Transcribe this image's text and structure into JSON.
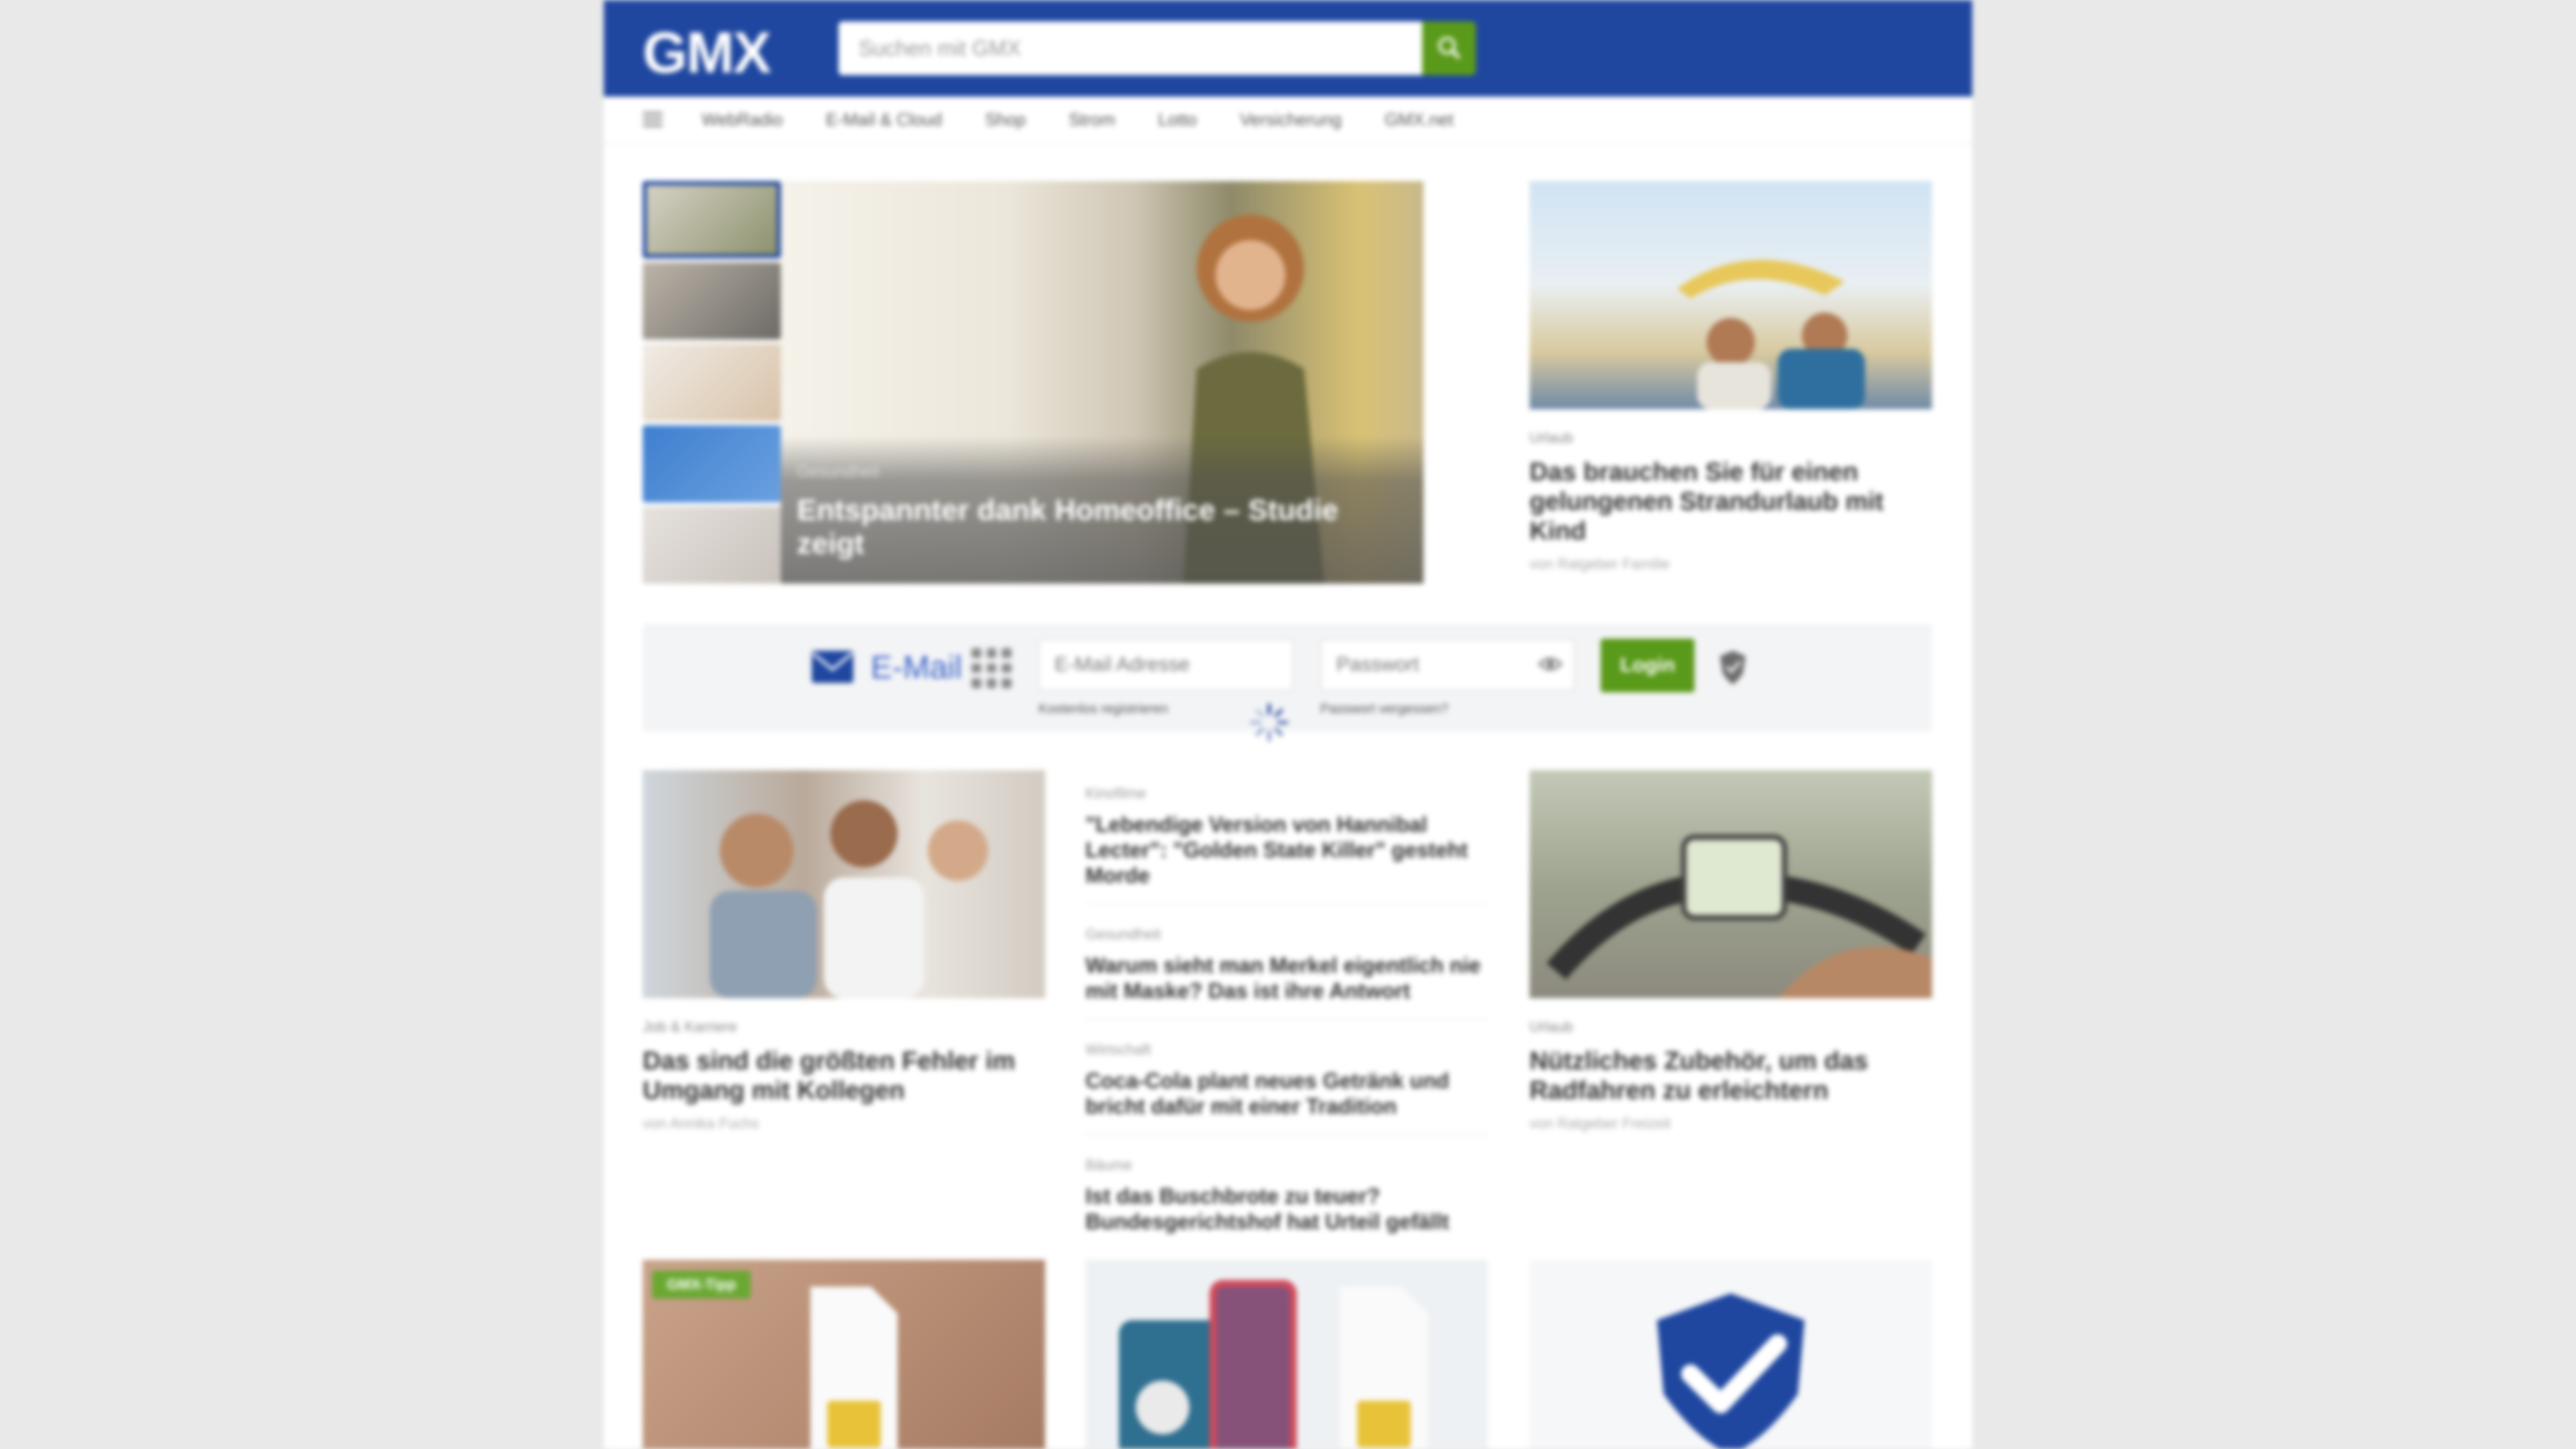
{
  "header": {
    "logo": "GMX",
    "search_placeholder": "Suchen mit GMX"
  },
  "nav": {
    "items": [
      "WebRadio",
      "E-Mail & Cloud",
      "Shop",
      "Strom",
      "Lotto",
      "Versicherung",
      "GMX.net"
    ]
  },
  "hero": {
    "kicker": "Gesundheit",
    "title": "Entspannter dank Homeoffice – Studie zeigt"
  },
  "side_article": {
    "kicker": "Urlaub",
    "title": "Das brauchen Sie für einen gelungenen Strandurlaub mit Kind",
    "meta": "von Ratgeber Familie"
  },
  "login": {
    "mail_label": "E-Mail",
    "email_placeholder": "E-Mail Adresse",
    "password_placeholder": "Passwort",
    "login_label": "Login",
    "register_link": "Kostenlos registrieren",
    "forgot_link": "Passwort vergessen?"
  },
  "articles": {
    "left": {
      "kicker": "Job & Karriere",
      "title": "Das sind die größten Fehler im Umgang mit Kollegen",
      "meta": "von Annika Fuchs"
    },
    "right": {
      "kicker": "Urlaub",
      "title": "Nützliches Zubehör, um das Radfahren zu erleichtern",
      "meta": "von Ratgeber Freizeit"
    },
    "list": [
      {
        "kicker": "Kinofilme",
        "title": "\"Lebendige Version von Hannibal Lecter\": \"Golden State Killer\" gesteht Morde"
      },
      {
        "kicker": "Gesundheit",
        "title": "Warum sieht man Merkel eigentlich nie mit Maske? Das ist ihre Antwort"
      },
      {
        "kicker": "Wirtschaft",
        "title": "Coca-Cola plant neues Getränk und bricht dafür mit einer Tradition"
      },
      {
        "kicker": "Bäume",
        "title": "Ist das Buschbrote zu teuer? Bundesgerichtshof hat Urteil gefällt"
      }
    ]
  },
  "promos": {
    "badge": "GMX-Tipp"
  },
  "colors": {
    "brand_blue": "#1f47a0",
    "accent_green": "#5a9a1a",
    "mail_blue": "#3b63c8"
  }
}
